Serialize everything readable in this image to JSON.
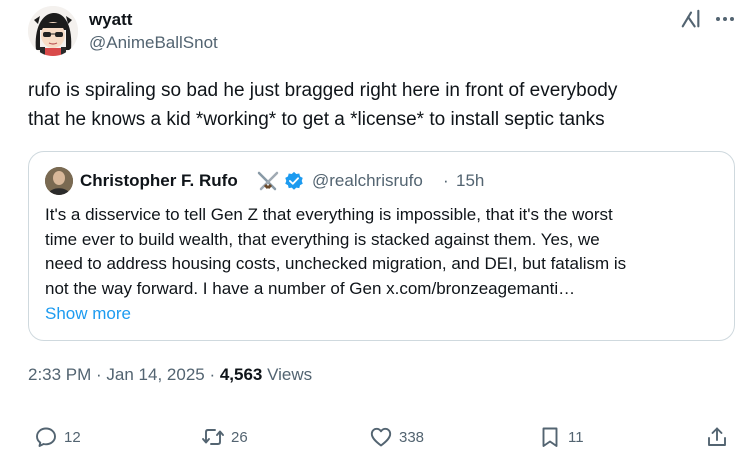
{
  "tweet": {
    "author": {
      "name": "wyatt",
      "handle": "@AnimeBallSnot"
    },
    "text_lines": [
      "rufo is spiraling so bad he just bragged right here in front of everybody",
      "that he knows a kid *working* to get a *license* to install septic tanks"
    ],
    "quote": {
      "author_name": "Christopher F. Rufo",
      "author_handle": "@realchrisrufo",
      "separator": "·",
      "time_ago": "15h",
      "text_lines": [
        "It's a disservice to tell Gen Z that everything is impossible, that it's the worst",
        "time ever to build wealth, that everything is stacked against them. Yes, we",
        "need to address housing costs, unchecked migration, and DEI, but fatalism is",
        "not the way forward. I have a number of Gen x.com/bronzeagemanti…"
      ],
      "show_more_label": "Show more"
    },
    "meta": {
      "time": "2:33 PM",
      "sep1": " · ",
      "date": "Jan 14, 2025",
      "sep2": " · ",
      "views_count": "4,563",
      "views_label": " Views"
    },
    "actions": {
      "replies": "12",
      "reposts": "26",
      "likes": "338",
      "bookmarks": "11"
    }
  },
  "colors": {
    "text_primary": "#0f1419",
    "text_secondary": "#536471",
    "link": "#1d9bf0",
    "border": "#cfd9de",
    "verified": "#1d9bf0"
  },
  "icons": [
    "grok-icon",
    "more-icon",
    "swords-icon",
    "verified-badge-icon",
    "reply-icon",
    "repost-icon",
    "like-icon",
    "bookmark-icon",
    "share-icon"
  ]
}
